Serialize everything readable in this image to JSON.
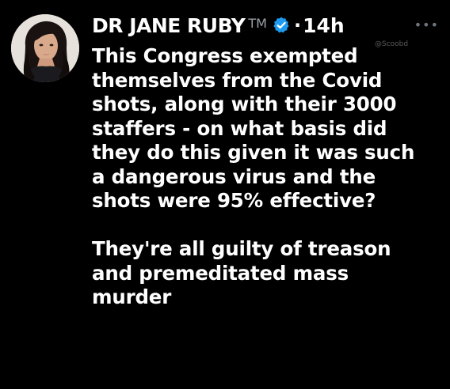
{
  "post": {
    "author": {
      "display_name": "DR JANE RUBY",
      "tm_mark": "TM",
      "verified": true,
      "verified_color": "#1d9bf0"
    },
    "separator": "·",
    "timestamp": "14h",
    "more_label": "•••",
    "watermark": "@Scoobd",
    "body_lines_p1": [
      "This Congress exempted",
      "themselves from the Covid",
      "shots, along with their 3000",
      "staffers - on what basis did",
      "they do this given it was such",
      "a dangerous virus and the",
      "shots were 95% effective?"
    ],
    "body_lines_p2": [
      "They're all guilty of treason",
      "and premeditated mass",
      "murder"
    ]
  },
  "colors": {
    "background": "#000000",
    "text": "#ffffff",
    "muted": "#6e767d"
  }
}
